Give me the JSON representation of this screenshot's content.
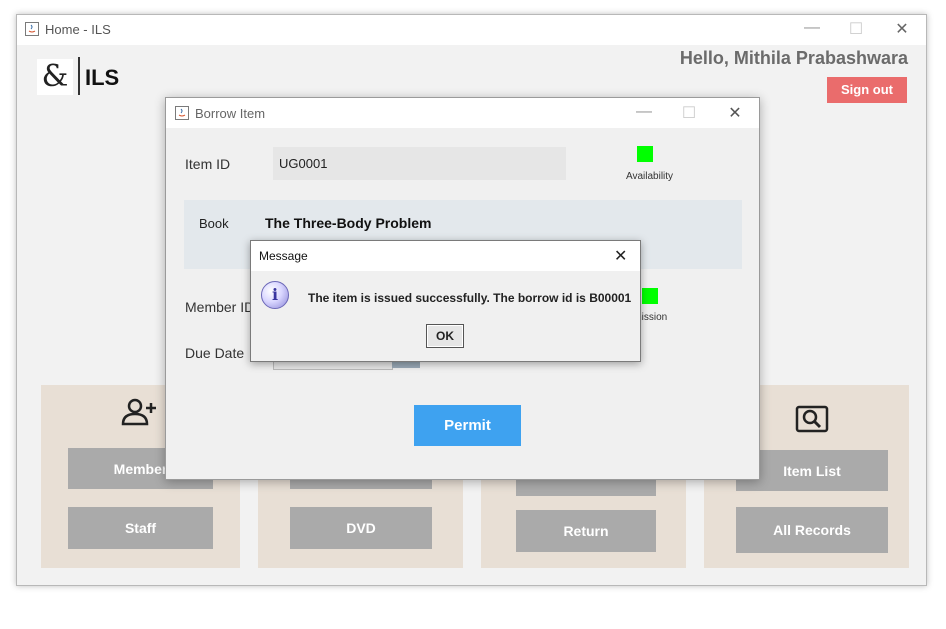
{
  "main_window": {
    "title": "Home - ILS",
    "greeting": "Hello, Mithila Prabashwara",
    "brand_logo": "&",
    "brand_name": "ILS",
    "sign_out_label": "Sign out",
    "sign_out_color": "#ea6c6c",
    "controls": {
      "minimize": "—",
      "maximize": "☐",
      "close": "✕"
    },
    "cards": [
      {
        "icon": "add-user-icon",
        "buttons": [
          "Member",
          "Staff"
        ]
      },
      {
        "icon": "",
        "buttons": [
          "",
          "DVD"
        ]
      },
      {
        "icon": "",
        "buttons": [
          "",
          "Return"
        ]
      },
      {
        "icon": "search-icon",
        "buttons": [
          "Item List",
          "All Records"
        ]
      }
    ]
  },
  "borrow_dialog": {
    "title": "Borrow Item",
    "item_id_label": "Item ID",
    "item_id_value": "UG0001",
    "availability_label": "Availability",
    "book_label": "Book",
    "book_title": "The Three-Body Problem",
    "member_id_label": "Member ID",
    "permission_label_partial": "rmission",
    "due_date_label": "Due Date",
    "permit_label": "Permit",
    "permit_color": "#3ea2f0",
    "status_color": "#00ff00"
  },
  "message_dialog": {
    "title": "Message",
    "icon": "info-icon",
    "text": "The item is issued successfully. The borrow id is B00001",
    "ok_label": "OK"
  }
}
